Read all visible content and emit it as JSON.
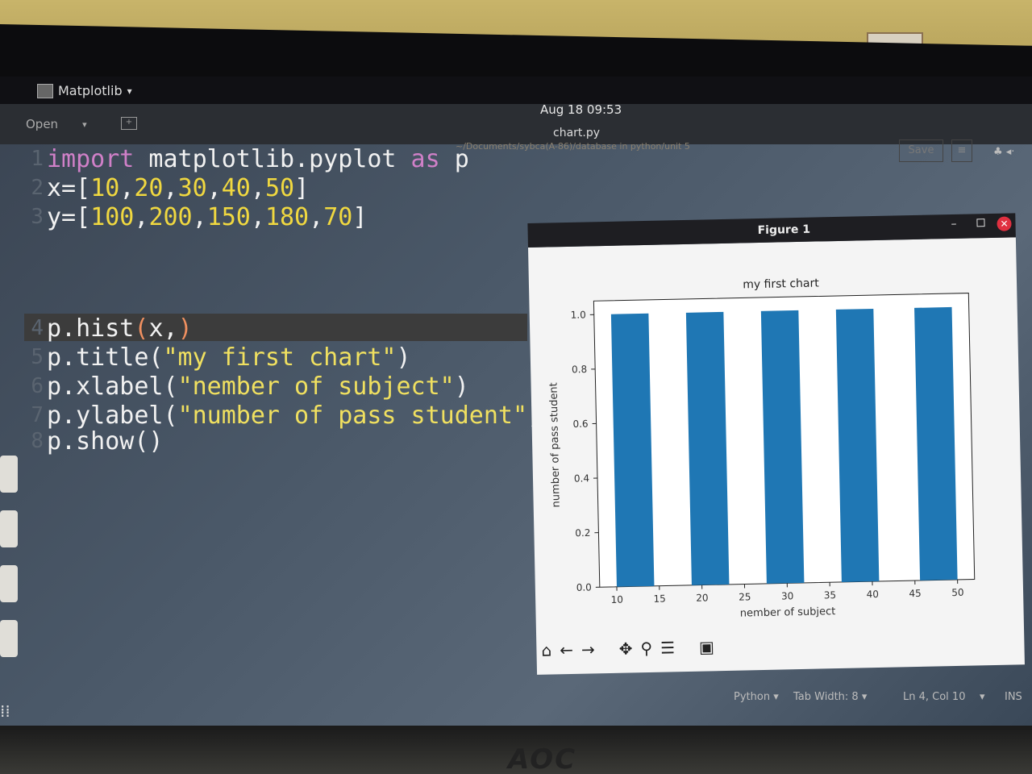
{
  "topbar": {
    "app_name": "Matplotlib",
    "app_chevron": "▾",
    "clock": "Aug 18  09:53"
  },
  "headerbar": {
    "open_label": "Open",
    "open_chevron": "▾",
    "file_title": "chart.py",
    "file_path": "~/Documents/sybca(A-86)/database in python/unit 5",
    "save_label": "Save",
    "menu_icon": "≡",
    "sys_icons": "♣ ◂·"
  },
  "editor": {
    "lines": [
      {
        "n": "1"
      },
      {
        "n": "2"
      },
      {
        "n": "3"
      },
      {
        "n": "4"
      },
      {
        "n": "5"
      },
      {
        "n": "6"
      },
      {
        "n": "7"
      },
      {
        "n": "8"
      }
    ],
    "tokens": {
      "l1": [
        "import",
        " matplotlib.pyplot ",
        "as",
        " p"
      ],
      "l2": [
        "x=[",
        "10",
        ",",
        "20",
        ",",
        "30",
        ",",
        "40",
        ",",
        "50",
        "]"
      ],
      "l3": [
        "y=[",
        "100",
        ",",
        "200",
        ",",
        "150",
        ",",
        "180",
        ",",
        "70",
        "]"
      ],
      "l4": [
        "p.hist",
        "(",
        "x,",
        ")"
      ],
      "l5": [
        "p.title(",
        "\"my first chart\"",
        ")"
      ],
      "l6": [
        "p.xlabel(",
        "\"nember of subject\"",
        ")"
      ],
      "l7": [
        "p.ylabel(",
        "\"number of pass student\"",
        ")"
      ],
      "l8": [
        "p.show()"
      ]
    }
  },
  "statusbar": {
    "language": "Python ▾",
    "tab_width": "Tab Width: 8 ▾",
    "cursor": "Ln 4, Col 10",
    "chevron": "▾",
    "mode": "INS"
  },
  "figure": {
    "window_title": "Figure 1",
    "min_icon": "–",
    "close_icon": "✕",
    "toolbar_icons": [
      "⌂",
      "←",
      "→",
      "✥",
      "⚲",
      "☰",
      "▣"
    ]
  },
  "brand": "AOC",
  "chart_data": {
    "type": "bar",
    "title": "my first chart",
    "xlabel": "nember of subject",
    "ylabel": "number of pass student",
    "xlim": [
      8,
      52
    ],
    "ylim": [
      0,
      1.05
    ],
    "xticks": [
      "10",
      "15",
      "20",
      "25",
      "30",
      "35",
      "40",
      "45",
      "50"
    ],
    "yticks": [
      "0.0",
      "0.2",
      "0.4",
      "0.6",
      "0.8",
      "1.0"
    ],
    "bins": [
      {
        "x0": 10,
        "x1": 14.4,
        "value": 1
      },
      {
        "x0": 18.8,
        "x1": 23.2,
        "value": 1
      },
      {
        "x0": 27.6,
        "x1": 32,
        "value": 1
      },
      {
        "x0": 36.4,
        "x1": 40.8,
        "value": 1
      },
      {
        "x0": 45.6,
        "x1": 50,
        "value": 1
      }
    ],
    "bar_color": "#1f77b4"
  }
}
